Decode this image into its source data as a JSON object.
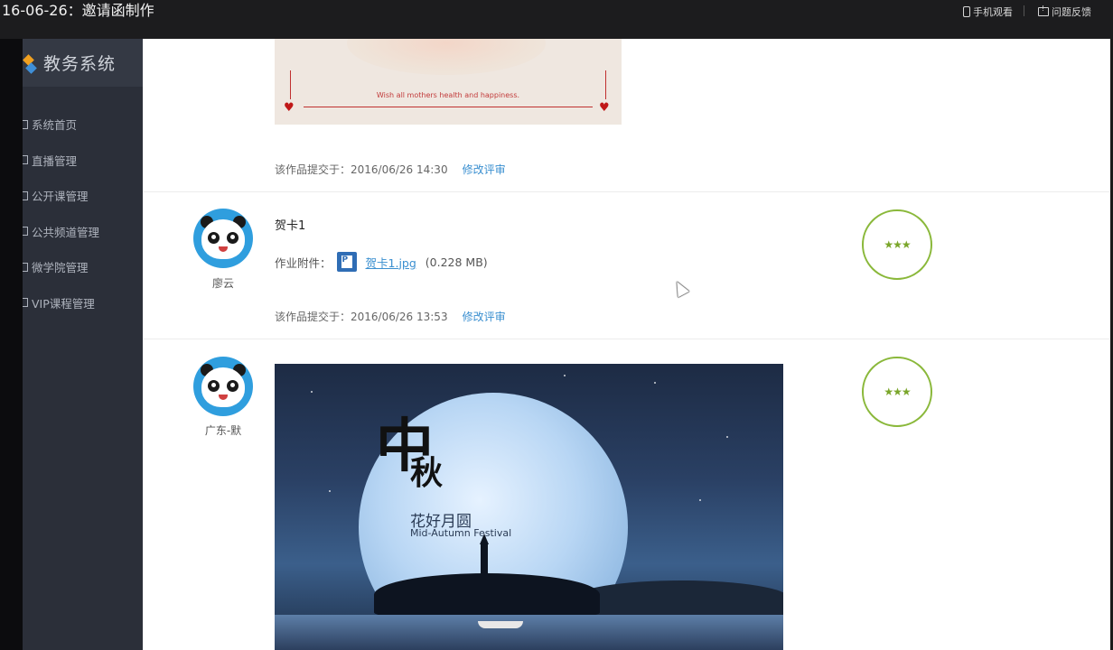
{
  "window": {
    "title": "16-06-26：邀请函制作",
    "tools": {
      "mobile_view": "手机观看",
      "feedback": "问题反馈"
    }
  },
  "sidebar": {
    "brand": "教务系统",
    "items": [
      {
        "label": "系统首页"
      },
      {
        "label": "直播管理"
      },
      {
        "label": "公开课管理"
      },
      {
        "label": "公共频道管理"
      },
      {
        "label": "微学院管理"
      },
      {
        "label": "VIP课程管理"
      }
    ]
  },
  "submissions": [
    {
      "image_caption": "Wish all mothers health and happiness.",
      "submitted_label": "该作品提交于：",
      "submitted_time": "2016/06/26 14:30",
      "edit_label": "修改评审"
    },
    {
      "user": "廖云",
      "title": "贺卡1",
      "attach_label": "作业附件：",
      "file_name": "贺卡1.jpg",
      "file_size": "(0.228 MB)",
      "submitted_label": "该作品提交于：",
      "submitted_time": "2016/06/26 13:53",
      "edit_label": "修改评审",
      "score": "★★★"
    },
    {
      "user": "广东-默",
      "score": "★★★",
      "image_text": {
        "big": "中",
        "big2": "秋",
        "cn": "花好月圆",
        "en": "Mid-Autumn Festival"
      }
    }
  ],
  "colors": {
    "accent": "#3a8fd0",
    "score": "#8ab83a",
    "sidebar": "#2b2f39"
  }
}
